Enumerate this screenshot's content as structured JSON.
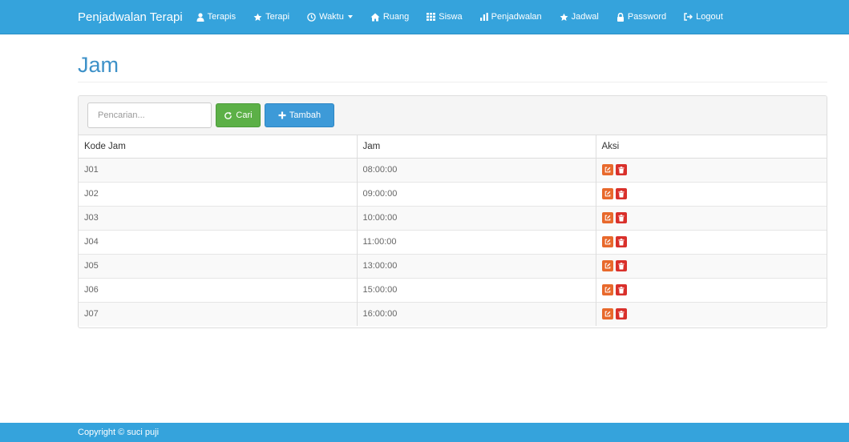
{
  "navbar": {
    "brand": "Penjadwalan Terapi",
    "items": [
      {
        "label": "Terapis",
        "icon": "user-icon"
      },
      {
        "label": "Terapi",
        "icon": "star-icon"
      },
      {
        "label": "Waktu",
        "icon": "clock-icon",
        "dropdown": true
      },
      {
        "label": "Ruang",
        "icon": "home-icon"
      },
      {
        "label": "Siswa",
        "icon": "grid-icon"
      },
      {
        "label": "Penjadwalan",
        "icon": "bar-chart-icon"
      },
      {
        "label": "Jadwal",
        "icon": "star-icon"
      },
      {
        "label": "Password",
        "icon": "lock-icon"
      },
      {
        "label": "Logout",
        "icon": "logout-icon"
      }
    ]
  },
  "page": {
    "title": "Jam"
  },
  "toolbar": {
    "search_placeholder": "Pencarian...",
    "search_value": "",
    "search_button": "Cari",
    "add_button": "Tambah"
  },
  "table": {
    "columns": [
      "Kode Jam",
      "Jam",
      "Aksi"
    ],
    "rows": [
      {
        "kode": "J01",
        "jam": "08:00:00"
      },
      {
        "kode": "J02",
        "jam": "09:00:00"
      },
      {
        "kode": "J03",
        "jam": "10:00:00"
      },
      {
        "kode": "J04",
        "jam": "11:00:00"
      },
      {
        "kode": "J05",
        "jam": "13:00:00"
      },
      {
        "kode": "J06",
        "jam": "15:00:00"
      },
      {
        "kode": "J07",
        "jam": "16:00:00"
      }
    ]
  },
  "footer": {
    "text": "Copyright © suci puji"
  },
  "colors": {
    "navbar": "#35a3dc",
    "title": "#3d91c8",
    "cari_button": "#5cb047",
    "tambah_button": "#3d9ad8",
    "edit_button": "#e8692c",
    "delete_button": "#d9302b"
  }
}
